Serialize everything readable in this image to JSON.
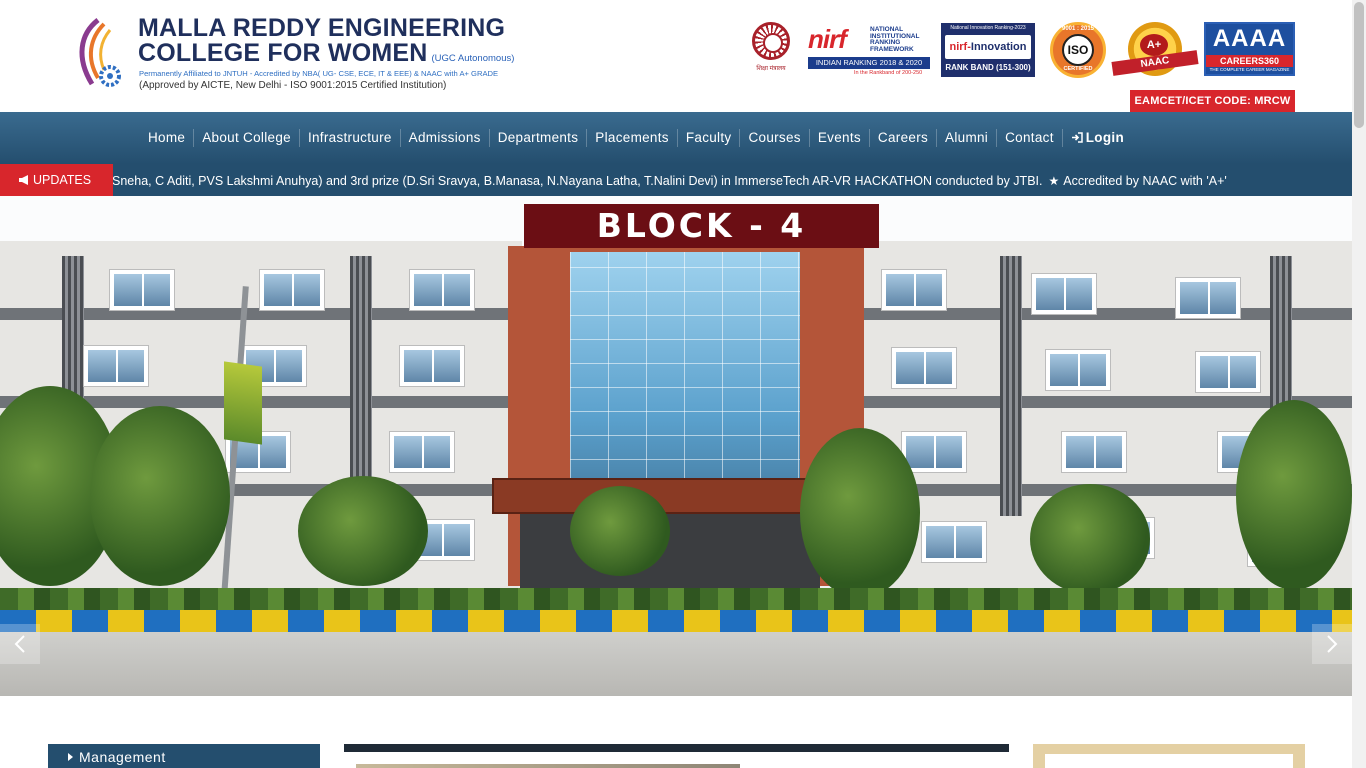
{
  "header": {
    "college_name_line1": "MALLA REDDY ENGINEERING",
    "college_name_line2": "COLLEGE FOR WOMEN",
    "ugc_tag": "(UGC Autonomous)",
    "affiliation": "Permanently Affiliated to JNTUH - Accredited by NBA( UG- CSE, ECE, IT & EEE) & NAAC with A+ GRADE",
    "approval": "(Approved by AICTE, New Delhi - ISO 9001:2015 Certified Institution)",
    "badges": {
      "education_ministry": "शिक्षा मंत्रालय",
      "nirf_prefix": "nir",
      "nirf_suffix": "f",
      "nirf_side": "NATIONAL INSTITUTIONAL RANKING FRAMEWORK",
      "nirf_band": "INDIAN RANKING 2018 & 2020",
      "nirf_foot": "In the Rankband of 200-250",
      "innovation_top": "National Innovation Ranking-2023",
      "innovation_prefix": "nirf-",
      "innovation_word": "Innovation",
      "innovation_band": "RANK BAND (151-300)",
      "iso_top": "9001 : 2015",
      "iso_mid": "ISO",
      "iso_bot": "CERTIFIED",
      "naac_grade": "A+",
      "naac_ribbon": "NAAC",
      "careers_grade": "AAAA",
      "careers_name": "CAREERS360",
      "careers_tagline": "THE COMPLETE CAREER MAGAZINE"
    },
    "eamcet_code": "EAMCET/ICET CODE: MRCW"
  },
  "nav": {
    "items": [
      "Home",
      "About College",
      "Infrastructure",
      "Admissions",
      "Departments",
      "Placements",
      "Faculty",
      "Courses",
      "Events",
      "Careers",
      "Alumni",
      "Contact"
    ],
    "login_label": "Login"
  },
  "ticker": {
    "label": "UPDATES",
    "text_1": "Sneha, C Aditi, PVS Lakshmi Anuhya) and 3rd prize (D.Sri Sravya, B.Manasa, N.Nayana Latha, T.Nalini Devi) in ImmerseTech AR-VR HACKATHON conducted by JTBI.",
    "text_2": "Accredited by NAAC with 'A+'"
  },
  "hero": {
    "sign_text": "BLOCK - 4"
  },
  "sections": {
    "management_label": "Management"
  },
  "colors": {
    "nav_bg": "#244e6e",
    "accent_red": "#d8262c",
    "title_navy": "#1f2f5c"
  }
}
